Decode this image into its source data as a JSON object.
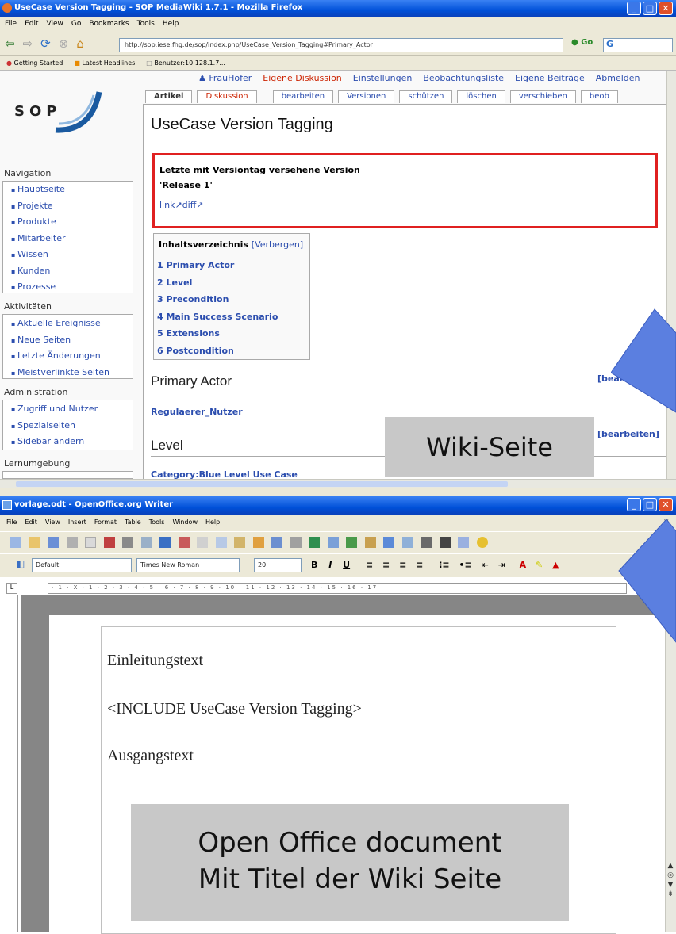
{
  "firefox": {
    "title": "UseCase Version Tagging - SOP MediaWiki 1.7.1 - Mozilla Firefox",
    "menu": [
      "File",
      "Edit",
      "View",
      "Go",
      "Bookmarks",
      "Tools",
      "Help"
    ],
    "url": "http://sop.iese.fhg.de/sop/index.php/UseCase_Version_Tagging#Primary_Actor",
    "go": "Go",
    "bookmarks": [
      "Getting Started",
      "Latest Headlines",
      "Benutzer:10.128.1.7..."
    ]
  },
  "wiki": {
    "logo": "SOP",
    "user_links": [
      "FrauHofer",
      "Eigene Diskussion",
      "Einstellungen",
      "Beobachtungsliste",
      "Eigene Beiträge",
      "Abmelden"
    ],
    "tabs": [
      "Artikel",
      "Diskussion",
      "bearbeiten",
      "Versionen",
      "schützen",
      "löschen",
      "verschieben",
      "beob"
    ],
    "page_title": "UseCase Version Tagging",
    "version_box": {
      "heading": "Letzte mit Versiontag versehene Version",
      "release": "'Release 1'",
      "links": "link↗diff↗"
    },
    "toc": {
      "title": "Inhaltsverzeichnis",
      "toggle": "[Verbergen]",
      "items": [
        "1 Primary Actor",
        "2 Level",
        "3 Precondition",
        "4 Main Success Scenario",
        "5 Extensions",
        "6 Postcondition"
      ]
    },
    "sections": [
      {
        "heading": "Primary Actor",
        "edit": "[bearbeiten]",
        "content": "Regulaerer_Nutzer"
      },
      {
        "heading": "Level",
        "edit": "[bearbeiten]",
        "content": "Category:Blue Level Use Case"
      }
    ],
    "sidebar": {
      "navigation": {
        "title": "Navigation",
        "items": [
          "Hauptseite",
          "Projekte",
          "Produkte",
          "Mitarbeiter",
          "Wissen",
          "Kunden",
          "Prozesse"
        ]
      },
      "aktivitaeten": {
        "title": "Aktivitäten",
        "items": [
          "Aktuelle Ereignisse",
          "Neue Seiten",
          "Letzte Änderungen",
          "Meistverlinkte Seiten"
        ]
      },
      "administration": {
        "title": "Administration",
        "items": [
          "Zugriff und Nutzer",
          "Spezialseiten",
          "Sidebar ändern"
        ]
      },
      "lernumgebung": {
        "title": "Lernumgebung"
      }
    }
  },
  "writer": {
    "title": "vorlage.odt - OpenOffice.org Writer",
    "menu": [
      "File",
      "Edit",
      "View",
      "Insert",
      "Format",
      "Table",
      "Tools",
      "Window",
      "Help"
    ],
    "style": "Default",
    "font": "Times New Roman",
    "size": "20",
    "ruler": "· 1 · X · 1 · 2 · 3 · 4 · 5 · 6 · 7 · 8 · 9 · 10 · 11 · 12 · 13 · 14 · 15 · 16 · 17",
    "lines": [
      "Einleitungstext",
      "<INCLUDE UseCase Version Tagging>",
      "Ausgangstext"
    ]
  },
  "annotations": {
    "wiki_label": "Wiki-Seite",
    "doc_label_1": "Open Office document",
    "doc_label_2": "Mit Titel der Wiki Seite"
  },
  "colors": {
    "arrow": "#5b7fe0",
    "link": "#2b4dae",
    "highlight_border": "#e02020",
    "label_bg": "#c8c8c8"
  }
}
